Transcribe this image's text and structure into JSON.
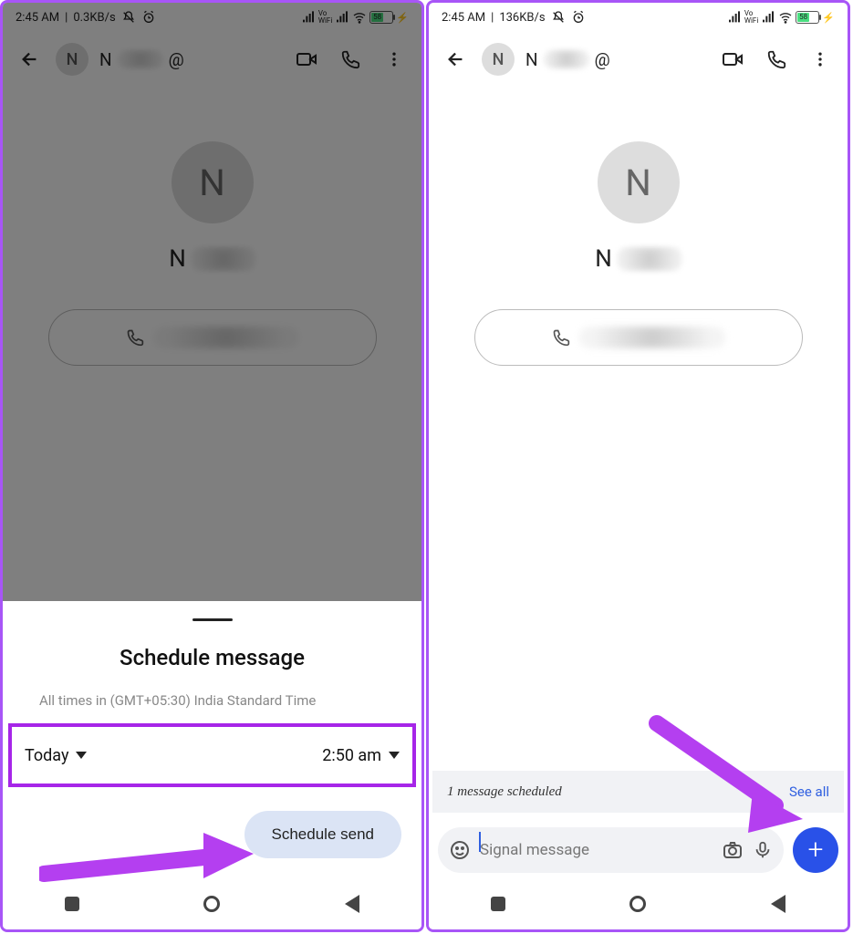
{
  "left": {
    "statusbar": {
      "time": "2:45 AM",
      "net": "0.3KB/s",
      "battery": "58"
    },
    "appbar": {
      "avatar_initial": "N",
      "contact_initial": "N",
      "at": "@"
    },
    "profile": {
      "avatar_initial": "N",
      "name_initial": "N"
    },
    "sheet": {
      "title": "Schedule message",
      "tz": "All times in (GMT+05:30) India Standard Time",
      "date": "Today",
      "time": "2:50 am",
      "button": "Schedule send"
    }
  },
  "right": {
    "statusbar": {
      "time": "2:45 AM",
      "net": "136KB/s",
      "battery": "58"
    },
    "appbar": {
      "avatar_initial": "N",
      "contact_initial": "N",
      "at": "@"
    },
    "profile": {
      "avatar_initial": "N",
      "name_initial": "N"
    },
    "banner": {
      "text": "1 message scheduled",
      "see_all": "See all"
    },
    "composer": {
      "placeholder": "Signal message"
    }
  }
}
